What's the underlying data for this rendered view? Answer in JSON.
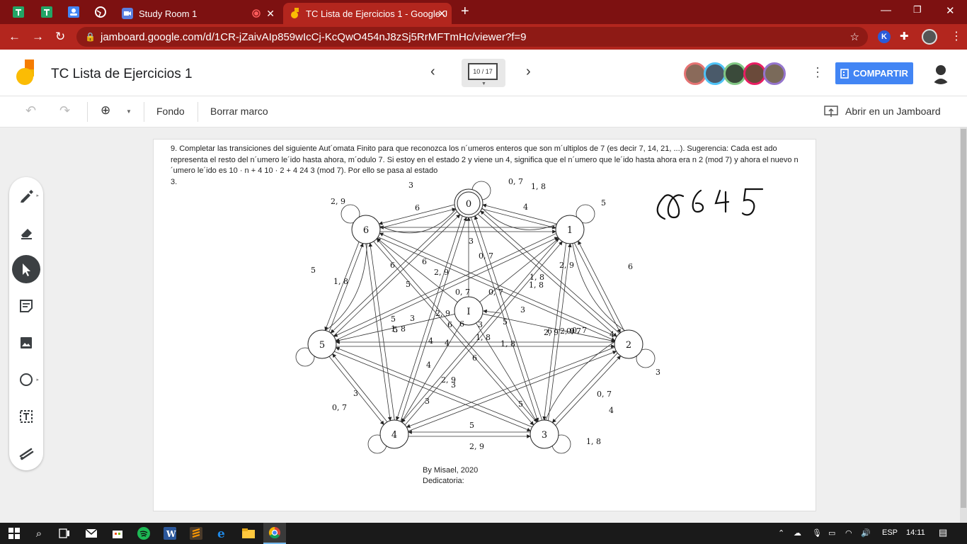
{
  "browser": {
    "tabs": [
      {
        "label": "Study Room 1"
      },
      {
        "label": "TC Lista de Ejercicios 1 - Google J"
      }
    ],
    "url": "jamboard.google.com/d/1CR-jZaivAIp859wIcCj-KcQwO454nJ8zSj5RrMFTmHc/viewer?f=9"
  },
  "app": {
    "title": "TC Lista de Ejercicios 1",
    "frame_indicator": "10 / 17",
    "share_label": "COMPARTIR"
  },
  "toolbar": {
    "fondo": "Fondo",
    "borrar": "Borrar marco",
    "abrir": "Abrir en un Jamboard"
  },
  "frame": {
    "problem_text": "9. Completar las transiciones del siguiente Aut´omata Finito para que reconozca los n´umeros enteros que son m´ultiplos de 7 (es decir 7, 14, 21, ...). Sugerencia: Cada est ado representa el resto del n´umero le´ido hasta ahora, m´odulo 7. Si estoy en el estado 2 y viene un 4, significa que el n´umero que le´ido hasta ahora era n 2 (mod 7) y ahora el nuevo n´umero le´ido es 10 · n + 4 10 · 2 + 4 24 3 (mod 7). Por ello se pasa al estado",
    "problem_tail": "3.",
    "byline": "By Misael, 2020",
    "dedication": "Dedicatoria:",
    "handwriting": "8645"
  },
  "diagram": {
    "states": [
      "0",
      "1",
      "2",
      "3",
      "4",
      "5",
      "6",
      "I"
    ],
    "labels": [
      "3",
      "0, 7",
      "1, 8",
      "2, 9",
      "6",
      "4",
      "5",
      "5",
      "1, 8",
      "3",
      "0, 7",
      "6",
      "6",
      "2, 9",
      "2, 9",
      "6",
      "1, 8",
      "5",
      "1, 8",
      "0, 7",
      "0, 7",
      "5",
      "3",
      "2, 9",
      "5",
      "6",
      "0, 7",
      "3",
      "2, 9",
      "1, 8",
      "4",
      "6",
      "3",
      "1, 8",
      "1, 8",
      "5",
      "4",
      "2, 9",
      "3",
      "4",
      "3",
      "5",
      "0, 7",
      "4",
      "0, 7",
      "3",
      "5",
      "2, 9",
      "1, 8",
      "3",
      "6",
      "4",
      "2, 9",
      "6",
      "0, 7"
    ]
  },
  "taskbar": {
    "lang": "ESP",
    "time": "14:11"
  }
}
